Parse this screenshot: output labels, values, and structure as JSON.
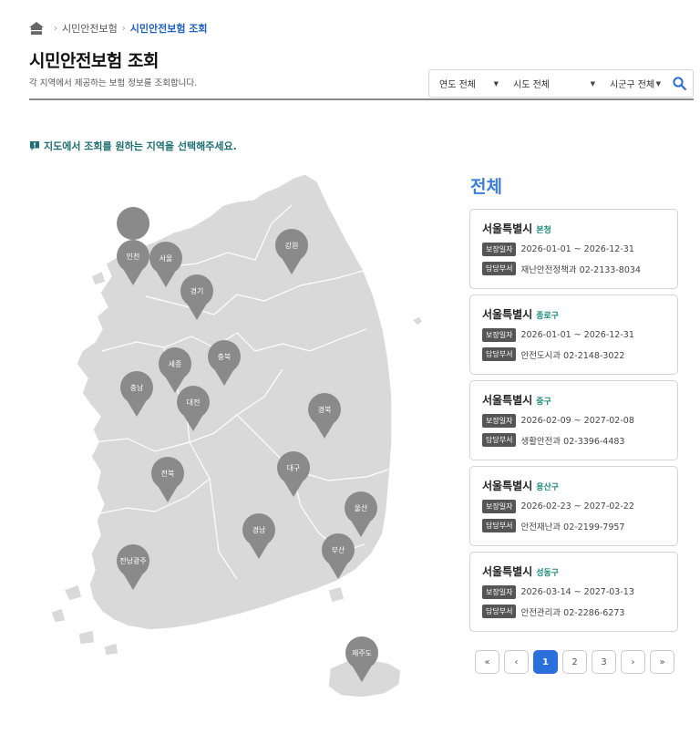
{
  "breadcrumb": {
    "home_icon": "home-icon",
    "items": [
      "시민안전보험",
      "시민안전보험 조회"
    ]
  },
  "header": {
    "title": "시민안전보험 조회",
    "description": "각 지역에서 제공하는 보험 정보를 조회합니다."
  },
  "filters": {
    "year": "연도 전체",
    "sido": "시도 전체",
    "sigungu": "시군구 전체",
    "search_icon": "search-icon"
  },
  "notice": {
    "text": "지도에서 조회를 원하는 지역을 선택해주세요."
  },
  "map": {
    "pins": [
      "인천",
      "서울",
      "경기",
      "강원",
      "충북",
      "세종",
      "충남",
      "대전",
      "경북",
      "대구",
      "전북",
      "울산",
      "경남",
      "부산",
      "전남광주",
      "제주도"
    ],
    "region_color": "#d9d9d9",
    "pin_color": "#8a8a8a"
  },
  "results": {
    "title": "전체",
    "period_label": "보장일자",
    "dept_label": "담당부서",
    "cards": [
      {
        "region": "서울특별시",
        "sub": "본청",
        "period": "2026-01-01 ~ 2026-12-31",
        "dept": "재난안전정책과 02-2133-8034"
      },
      {
        "region": "서울특별시",
        "sub": "종로구",
        "period": "2026-01-01 ~ 2026-12-31",
        "dept": "안전도시과 02-2148-3022"
      },
      {
        "region": "서울특별시",
        "sub": "중구",
        "period": "2026-02-09 ~ 2027-02-08",
        "dept": "생활안전과 02-3396-4483"
      },
      {
        "region": "서울특별시",
        "sub": "용산구",
        "period": "2026-02-23 ~ 2027-02-22",
        "dept": "안전재난과 02-2199-7957"
      },
      {
        "region": "서울특별시",
        "sub": "성동구",
        "period": "2026-03-14 ~ 2027-03-13",
        "dept": "안전관리과 02-2286-6273"
      }
    ]
  },
  "pagination": {
    "first": "«",
    "prev": "‹",
    "pages": [
      "1",
      "2",
      "3"
    ],
    "next": "›",
    "last": "»",
    "active_page": "1"
  },
  "colors": {
    "accent": "#2a6fdb",
    "notice": "#1e6f73",
    "sub_label": "#1e8a7a"
  }
}
